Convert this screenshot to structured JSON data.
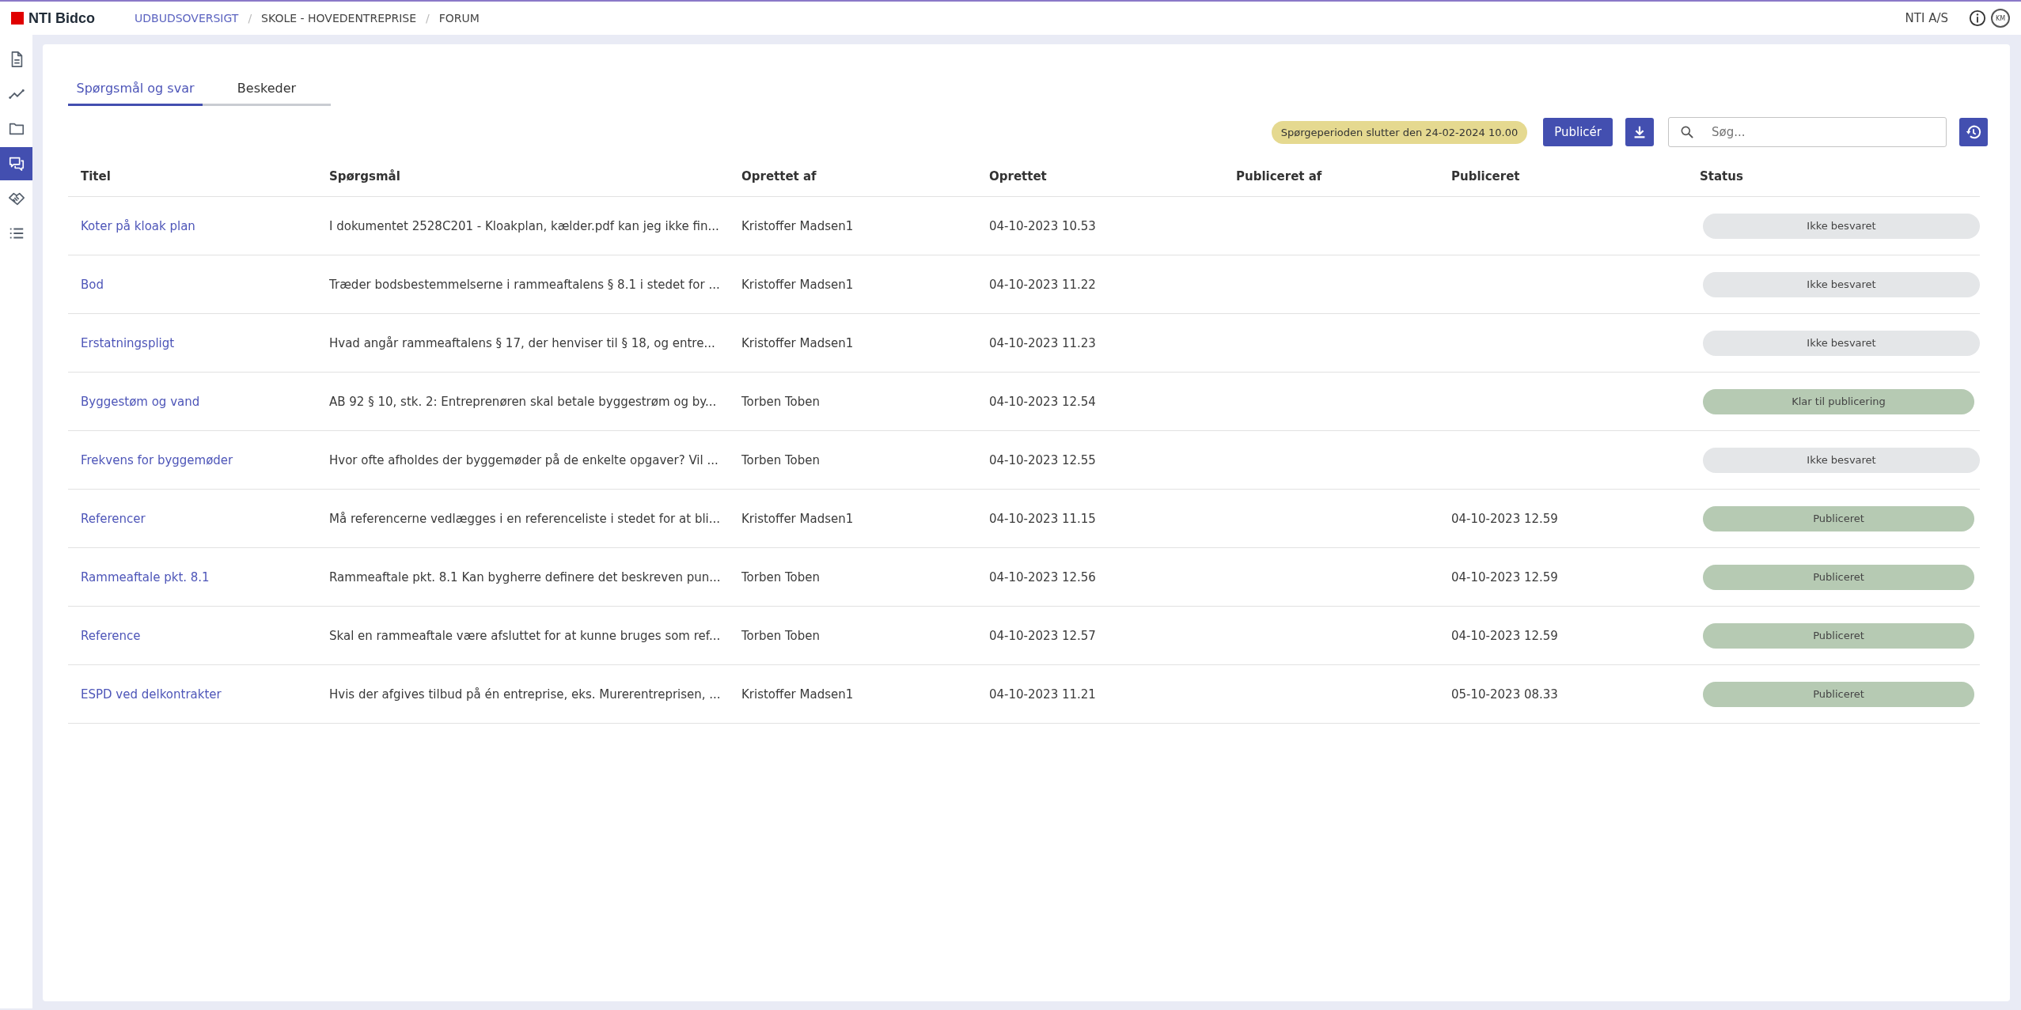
{
  "header": {
    "logo": "NTI Bidco",
    "breadcrumbs": [
      {
        "label": "UDBUDSOVERSIGT",
        "link": true
      },
      {
        "separator": "/",
        "label": "SKOLE - HOVEDENTREPRISE",
        "link": false
      },
      {
        "separator": "/",
        "label": "FORUM",
        "link": false
      }
    ],
    "company": "NTI A/S",
    "avatar": "KM"
  },
  "sidebar": {
    "items": [
      {
        "selected": false
      },
      {
        "selected": false
      },
      {
        "selected": false
      },
      {
        "selected": true
      },
      {
        "selected": false
      },
      {
        "selected": false
      }
    ]
  },
  "tabs": [
    {
      "label": "Spørgsmål og svar",
      "selected": true
    },
    {
      "label": "Beskeder",
      "selected": false
    }
  ],
  "toolbar": {
    "deadline": "Spørgeperioden slutter den 24-02-2024 10.00",
    "publish_button": "Publicér",
    "search": {
      "placeholder": "Søg..."
    }
  },
  "table": {
    "columns": [
      "Titel",
      "Spørgsmål",
      "Oprettet af",
      "Oprettet",
      "Publiceret af",
      "Publiceret",
      "Status"
    ],
    "rows": [
      {
        "title": "Koter på kloak plan",
        "question": "I dokumentet 2528C201 - Kloakplan, kælder.pdf kan jeg ikke fin...",
        "created_by": "Kristoffer Madsen1",
        "created": "04-10-2023 10.53",
        "published": "",
        "status": {
          "kind": "open",
          "label": "Ikke besvaret"
        }
      },
      {
        "title": "Bod",
        "question": "Træder bodsbestemmelserne i rammeaftalens § 8.1 i stedet for ...",
        "created_by": "Kristoffer Madsen1",
        "created": "04-10-2023 11.22",
        "published": "",
        "status": {
          "kind": "open",
          "label": "Ikke besvaret"
        }
      },
      {
        "title": "Erstatningspligt",
        "question": "Hvad angår rammeaftalens § 17, der henviser til § 18, og entre...",
        "created_by": "Kristoffer Madsen1",
        "created": "04-10-2023 11.23",
        "published": "",
        "status": {
          "kind": "open",
          "label": "Ikke besvaret"
        }
      },
      {
        "title": "Byggestøm og vand",
        "question": "AB 92 § 10, stk. 2: Entreprenøren skal betale byggestrøm og by...",
        "created_by": "Torben Toben",
        "created": "04-10-2023 12.54",
        "published": "",
        "status": {
          "kind": "done",
          "label": "Klar til publicering"
        }
      },
      {
        "title": "Frekvens for byggemøder",
        "question": "Hvor ofte afholdes der byggemøder på de enkelte opgaver? Vil ...",
        "created_by": "Torben Toben",
        "created": "04-10-2023 12.55",
        "published": "",
        "status": {
          "kind": "open",
          "label": "Ikke besvaret"
        }
      },
      {
        "title": "Referencer",
        "question": "Må referencerne vedlægges i en referenceliste i stedet for at bli...",
        "created_by": "Kristoffer Madsen1",
        "created": "04-10-2023 11.15",
        "published": "04-10-2023 12.59",
        "status": {
          "kind": "done",
          "label": "Publiceret"
        }
      },
      {
        "title": "Rammeaftale pkt. 8.1",
        "question": "Rammeaftale pkt. 8.1 Kan bygherre definere det beskreven pun...",
        "created_by": "Torben Toben",
        "created": "04-10-2023 12.56",
        "published": "04-10-2023 12.59",
        "status": {
          "kind": "done",
          "label": "Publiceret"
        }
      },
      {
        "title": "Reference",
        "question": "Skal en rammeaftale være afsluttet for at kunne bruges som ref...",
        "created_by": "Torben Toben",
        "created": "04-10-2023 12.57",
        "published": "04-10-2023 12.59",
        "status": {
          "kind": "done",
          "label": "Publiceret"
        }
      },
      {
        "title": "ESPD ved delkontrakter",
        "question": "Hvis der afgives tilbud på én entreprise, eks. Murerentreprisen, ...",
        "created_by": "Kristoffer Madsen1",
        "created": "04-10-2023 11.21",
        "published": "05-10-2023 08.33",
        "status": {
          "kind": "done",
          "label": "Publiceret"
        }
      }
    ]
  }
}
